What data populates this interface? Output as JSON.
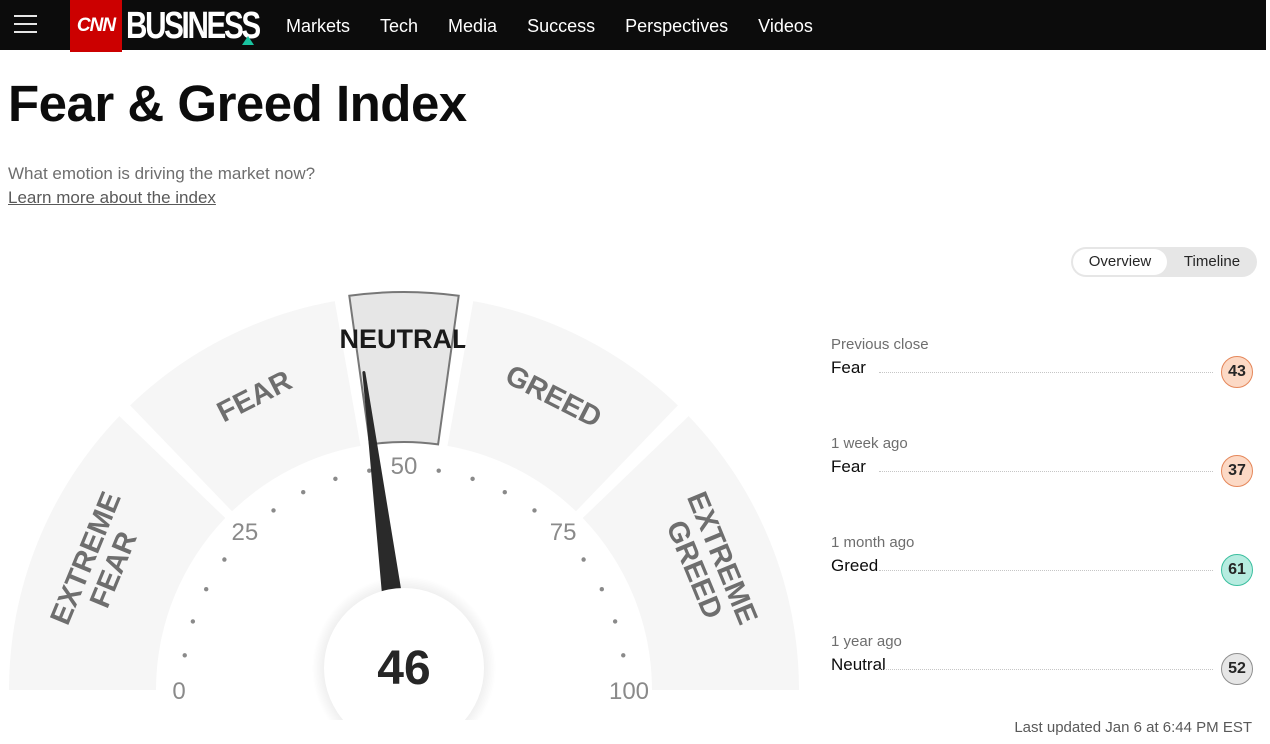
{
  "brand": {
    "logo_box": "CNN",
    "logo_text": "BUSINESS"
  },
  "nav": {
    "items": [
      "Markets",
      "Tech",
      "Media",
      "Success",
      "Perspectives",
      "Videos"
    ]
  },
  "header": {
    "title": "Fear & Greed Index",
    "subtitle": "What emotion is driving the market now?",
    "learn_link": "Learn more about the index"
  },
  "toggle": {
    "overview": "Overview",
    "timeline": "Timeline",
    "selected": "Overview"
  },
  "gauge": {
    "value": 46,
    "value_label": "46",
    "min": 0,
    "max": 100,
    "active_zone": "Neutral",
    "zones": [
      {
        "label": "EXTREME FEAR",
        "from": 0,
        "to": 25
      },
      {
        "label": "FEAR",
        "from": 25,
        "to": 45
      },
      {
        "label": "NEUTRAL",
        "from": 45,
        "to": 55
      },
      {
        "label": "GREED",
        "from": 55,
        "to": 75
      },
      {
        "label": "EXTREME GREED",
        "from": 75,
        "to": 100
      }
    ],
    "tick_labels": [
      "0",
      "25",
      "50",
      "75",
      "100"
    ]
  },
  "history": [
    {
      "label": "Previous close",
      "status": "Fear",
      "value": "43",
      "color": "#fcd9c5",
      "border": "#e5875a"
    },
    {
      "label": "1 week ago",
      "status": "Fear",
      "value": "37",
      "color": "#fcd9c5",
      "border": "#e5875a"
    },
    {
      "label": "1 month ago",
      "status": "Greed",
      "value": "61",
      "color": "#b6ece0",
      "border": "#3bbf9f"
    },
    {
      "label": "1 year ago",
      "status": "Neutral",
      "value": "52",
      "color": "#e6e6e6",
      "border": "#8e8e8e"
    }
  ],
  "last_updated": "Last updated Jan 6 at 6:44 PM EST"
}
